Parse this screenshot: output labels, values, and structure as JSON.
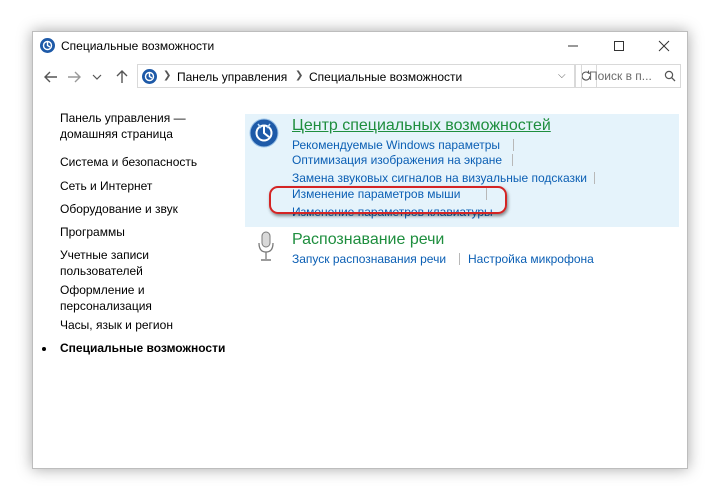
{
  "window": {
    "title": "Специальные возможности",
    "icon": "ease-of-access-icon"
  },
  "controls": {
    "minimize": "minimize-icon",
    "maximize": "maximize-icon",
    "close": "close-icon"
  },
  "navigation": {
    "back": "back-arrow-icon",
    "forward": "forward-arrow-icon",
    "recent": "chevron-down-icon",
    "up": "up-arrow-icon",
    "breadcrumbs": [
      "Панель управления",
      "Специальные возможности"
    ],
    "search_placeholder": "Поиск в п..."
  },
  "sidebar": {
    "home": "Панель управления —\nдомашняя страница",
    "items": [
      "Система и безопасность",
      "Сеть и Интернет",
      "Оборудование и звук",
      "Программы",
      "Учетные записи\nпользователей",
      "Оформление и\nперсонализация",
      "Часы, язык и регион",
      "Специальные возможности"
    ],
    "current_index": 7
  },
  "categories": [
    {
      "title": "Центр специальных возможностей",
      "links": [
        "Рекомендуемые Windows параметры",
        "Оптимизация изображения на экране",
        "Замена звуковых сигналов на визуальные подсказки",
        "Изменение параметров мыши",
        "Изменение параметров клавиатуры"
      ]
    },
    {
      "title": "Распознавание речи",
      "links": [
        "Запуск распознавания речи",
        "Настройка микрофона"
      ]
    }
  ],
  "colors": {
    "category_title": "#1e8e3e",
    "link": "#0b5fb4",
    "highlight_bg": "#e5f3fb",
    "annotation_ring": "#d42424"
  }
}
